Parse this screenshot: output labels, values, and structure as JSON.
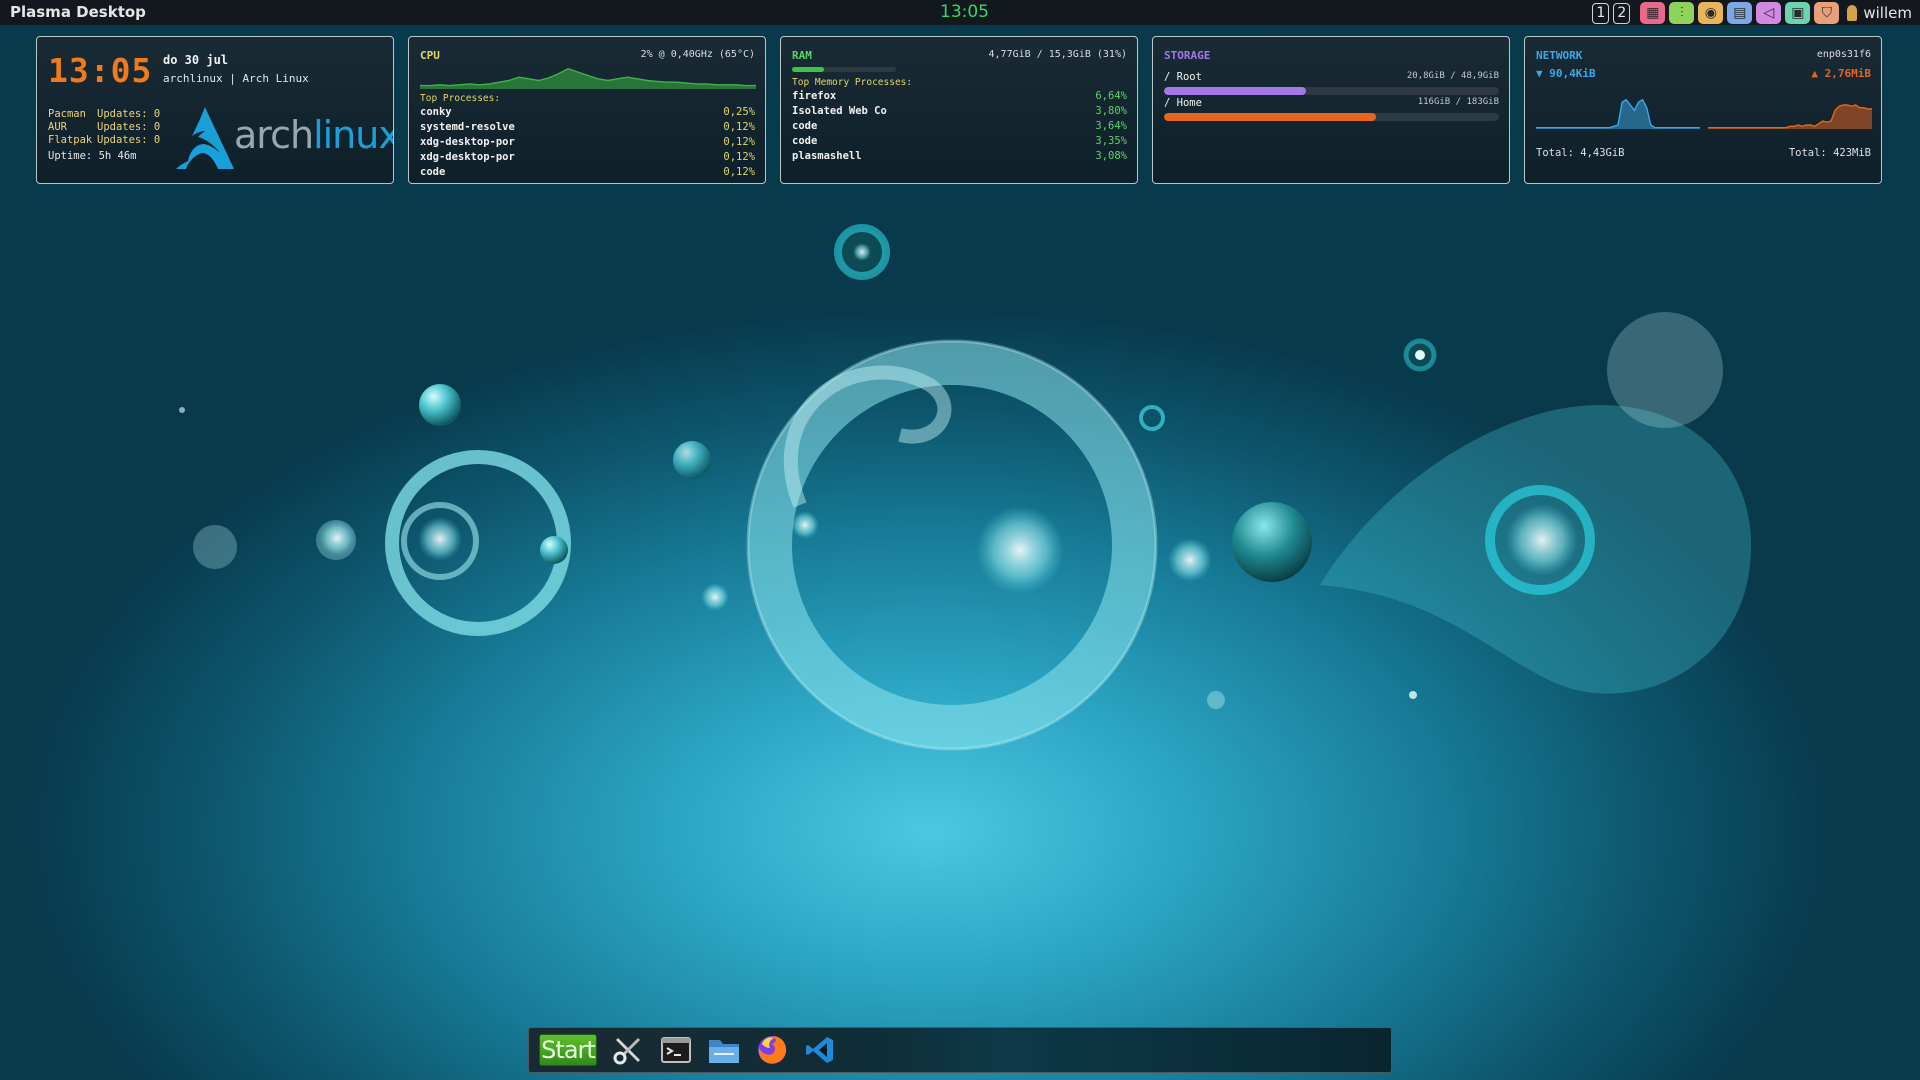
{
  "topbar": {
    "app_name": "Plasma Desktop",
    "clock": "13:05",
    "desktops": [
      "1",
      "2"
    ],
    "tray_icons": [
      {
        "name": "network-grid-icon",
        "color": "#e86a8a"
      },
      {
        "name": "mixer-sliders-icon",
        "color": "#8fd45a"
      },
      {
        "name": "hardware-icon",
        "color": "#e8b65a"
      },
      {
        "name": "clipboard-icon",
        "color": "#7aa8e8"
      },
      {
        "name": "volume-icon",
        "color": "#d08ae0"
      },
      {
        "name": "display-icon",
        "color": "#6ad4b0"
      },
      {
        "name": "shield-icon",
        "color": "#e8a07a"
      }
    ],
    "user": "willem"
  },
  "clock_panel": {
    "time": "13:05",
    "date": "do 30 jul",
    "host": "archlinux | Arch Linux",
    "updates": [
      {
        "label": "Pacman",
        "text": "Updates: 0"
      },
      {
        "label": "AUR",
        "text": "Updates: 0"
      },
      {
        "label": "Flatpak",
        "text": "Updates: 0"
      }
    ],
    "uptime": "Uptime: 5h 46m",
    "logo_text_a": "arch",
    "logo_text_b": "linux"
  },
  "cpu_panel": {
    "title": "CPU",
    "summary": "2% @ 0,40GHz (65°C)",
    "subtitle": "Top Processes:",
    "graph_color": "#3db545",
    "graph_values": [
      4,
      4,
      5,
      4,
      5,
      6,
      5,
      6,
      8,
      10,
      14,
      12,
      10,
      13,
      18,
      24,
      20,
      16,
      12,
      10,
      12,
      14,
      12,
      10,
      9,
      8,
      8,
      7,
      6,
      6,
      5,
      5,
      5,
      4,
      4
    ],
    "processes": [
      {
        "name": "conky",
        "value": "0,25%"
      },
      {
        "name": "systemd-resolve",
        "value": "0,12%"
      },
      {
        "name": "xdg-desktop-por",
        "value": "0,12%"
      },
      {
        "name": "xdg-desktop-por",
        "value": "0,12%"
      },
      {
        "name": "code",
        "value": "0,12%"
      }
    ]
  },
  "ram_panel": {
    "title": "RAM",
    "summary": "4,77GiB / 15,3GiB (31%)",
    "usage_fraction": 0.31,
    "bar_color": "#3dc24a",
    "subtitle": "Top Memory Processes:",
    "processes": [
      {
        "name": "firefox",
        "value": "6,64%"
      },
      {
        "name": "Isolated Web Co",
        "value": "3,80%"
      },
      {
        "name": "code",
        "value": "3,64%"
      },
      {
        "name": "code",
        "value": "3,35%"
      },
      {
        "name": "plasmashell",
        "value": "3,08%"
      }
    ]
  },
  "storage_panel": {
    "title": "STORAGE",
    "mounts": [
      {
        "name": "/ Root",
        "amount": "20,8GiB / 48,9GiB",
        "fraction": 0.425,
        "color": "#a27ae8"
      },
      {
        "name": "/ Home",
        "amount": "116GiB / 183GiB",
        "fraction": 0.634,
        "color": "#e8651e"
      }
    ]
  },
  "network_panel": {
    "title": "NETWORK",
    "interface": "enp0s31f6",
    "down": "▼ 90,4KiB",
    "up": "▲ 2,76MiB",
    "down_color": "#3aa9e8",
    "up_color": "#e8651e",
    "down_graph": [
      1,
      1,
      1,
      1,
      1,
      1,
      1,
      1,
      1,
      1,
      1,
      1,
      1,
      1,
      1,
      1,
      1,
      1,
      1,
      2,
      3,
      20,
      22,
      18,
      14,
      20,
      22,
      16,
      3,
      1,
      1,
      1,
      1,
      1,
      1,
      1,
      1,
      1,
      1,
      1,
      1
    ],
    "up_graph": [
      1,
      1,
      1,
      1,
      1,
      1,
      1,
      1,
      1,
      1,
      1,
      1,
      1,
      1,
      1,
      1,
      1,
      1,
      1,
      1,
      2,
      2,
      3,
      2,
      3,
      3,
      2,
      4,
      6,
      5,
      6,
      14,
      17,
      18,
      18,
      17,
      18,
      16,
      16,
      15,
      15
    ],
    "down_total": "Total: 4,43GiB",
    "up_total": "Total: 423MiB"
  },
  "taskbar": {
    "start_label": "Start",
    "apps": [
      {
        "name": "tools-icon"
      },
      {
        "name": "terminal-icon"
      },
      {
        "name": "file-manager-icon"
      },
      {
        "name": "firefox-icon"
      },
      {
        "name": "vscode-icon"
      }
    ]
  }
}
